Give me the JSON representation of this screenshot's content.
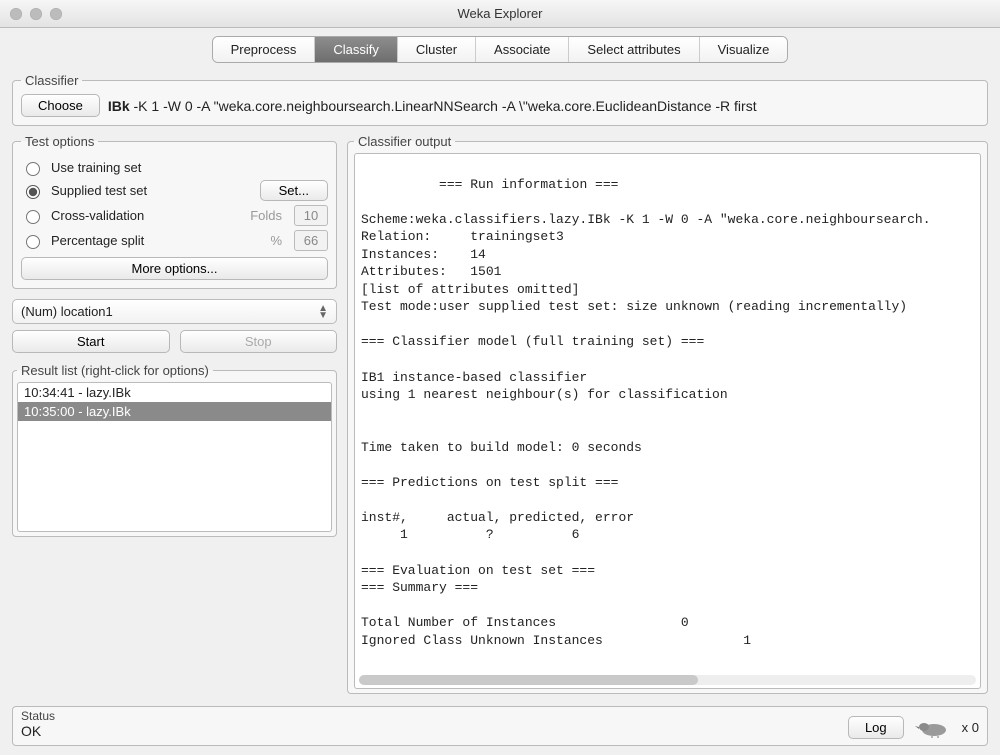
{
  "window": {
    "title": "Weka Explorer"
  },
  "tabs": {
    "preprocess": "Preprocess",
    "classify": "Classify",
    "cluster": "Cluster",
    "associate": "Associate",
    "select_attributes": "Select attributes",
    "visualize": "Visualize"
  },
  "classifier_panel": {
    "legend": "Classifier",
    "choose_btn": "Choose",
    "algo_name": "IBk",
    "algo_args": " -K 1 -W 0 -A \"weka.core.neighboursearch.LinearNNSearch -A \\\"weka.core.EuclideanDistance -R first"
  },
  "test_options": {
    "legend": "Test options",
    "use_training": "Use training set",
    "supplied": "Supplied test set",
    "set_btn": "Set...",
    "crossval": "Cross-validation",
    "folds_label": "Folds",
    "folds_value": "10",
    "percentage": "Percentage split",
    "pct_label": "%",
    "pct_value": "66",
    "more_options": "More options..."
  },
  "class_attr": {
    "selected": "(Num) location1"
  },
  "buttons": {
    "start": "Start",
    "stop": "Stop"
  },
  "result_list": {
    "legend": "Result list (right-click for options)",
    "items": [
      "10:34:41 - lazy.IBk",
      "10:35:00 - lazy.IBk"
    ],
    "selected_index": 1
  },
  "output": {
    "legend": "Classifier output",
    "text": "=== Run information ===\n\nScheme:weka.classifiers.lazy.IBk -K 1 -W 0 -A \"weka.core.neighboursearch.\nRelation:     trainingset3\nInstances:    14\nAttributes:   1501\n[list of attributes omitted]\nTest mode:user supplied test set: size unknown (reading incrementally)\n\n=== Classifier model (full training set) ===\n\nIB1 instance-based classifier\nusing 1 nearest neighbour(s) for classification\n\n\nTime taken to build model: 0 seconds\n\n=== Predictions on test split ===\n\ninst#,     actual, predicted, error\n     1          ?          6\n\n=== Evaluation on test set ===\n=== Summary ===\n\nTotal Number of Instances                0\nIgnored Class Unknown Instances                  1"
  },
  "status": {
    "legend": "Status",
    "value": "OK",
    "log_btn": "Log",
    "counter": "x 0"
  }
}
